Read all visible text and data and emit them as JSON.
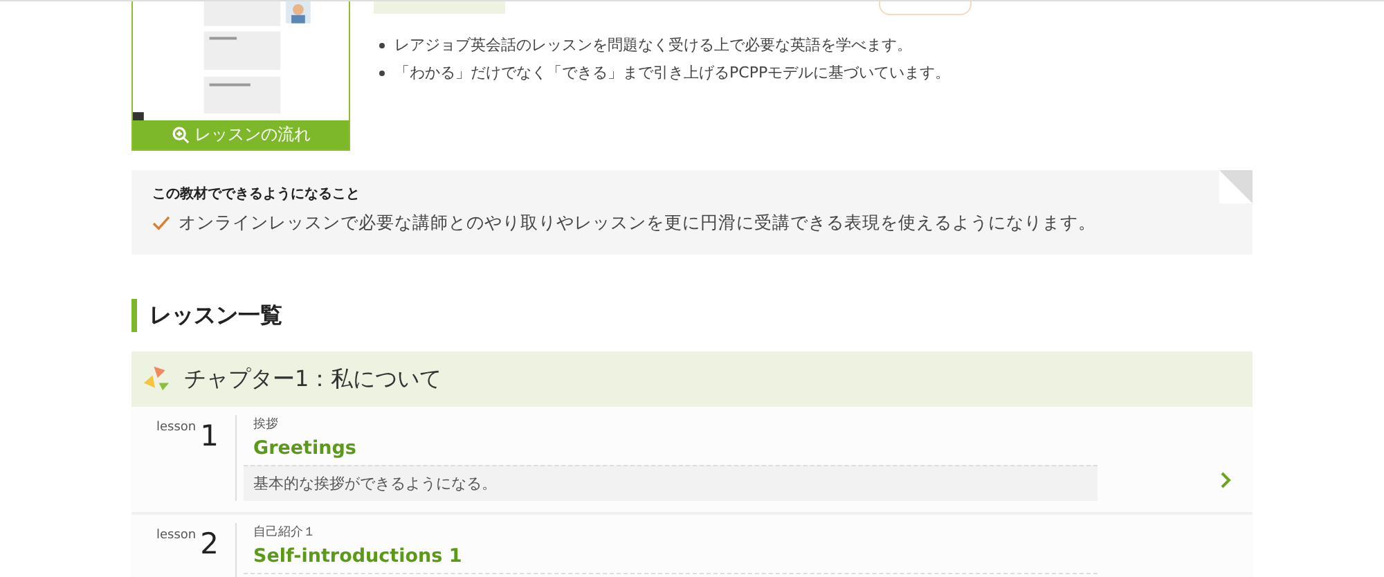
{
  "thumbnail": {
    "kind": "picture",
    "caption": "レッスンの流れ"
  },
  "features": [
    "レアジョブ英会話のレッスンを問題なく受ける上で必要な英語を学べます。",
    "「わかる」だけでなく「できる」まで引き上げるPCPPモデルに基づいています。"
  ],
  "goals": {
    "title": "この教材でできるようになること",
    "items": [
      "オンラインレッスンで必要な講師とのやり取りやレッスンを更に円滑に受講できる表現を使えるようになります。"
    ]
  },
  "lessons_heading": "レッスン一覧",
  "chapters": [
    {
      "title": "チャプター1：私について",
      "lessons": [
        {
          "prefix": "lesson",
          "number": "1",
          "category": "挨拶",
          "title": "Greetings",
          "description": "基本的な挨拶ができるようになる。"
        },
        {
          "prefix": "lesson",
          "number": "2",
          "category": "自己紹介１",
          "title": "Self-introductions 1"
        }
      ]
    }
  ]
}
